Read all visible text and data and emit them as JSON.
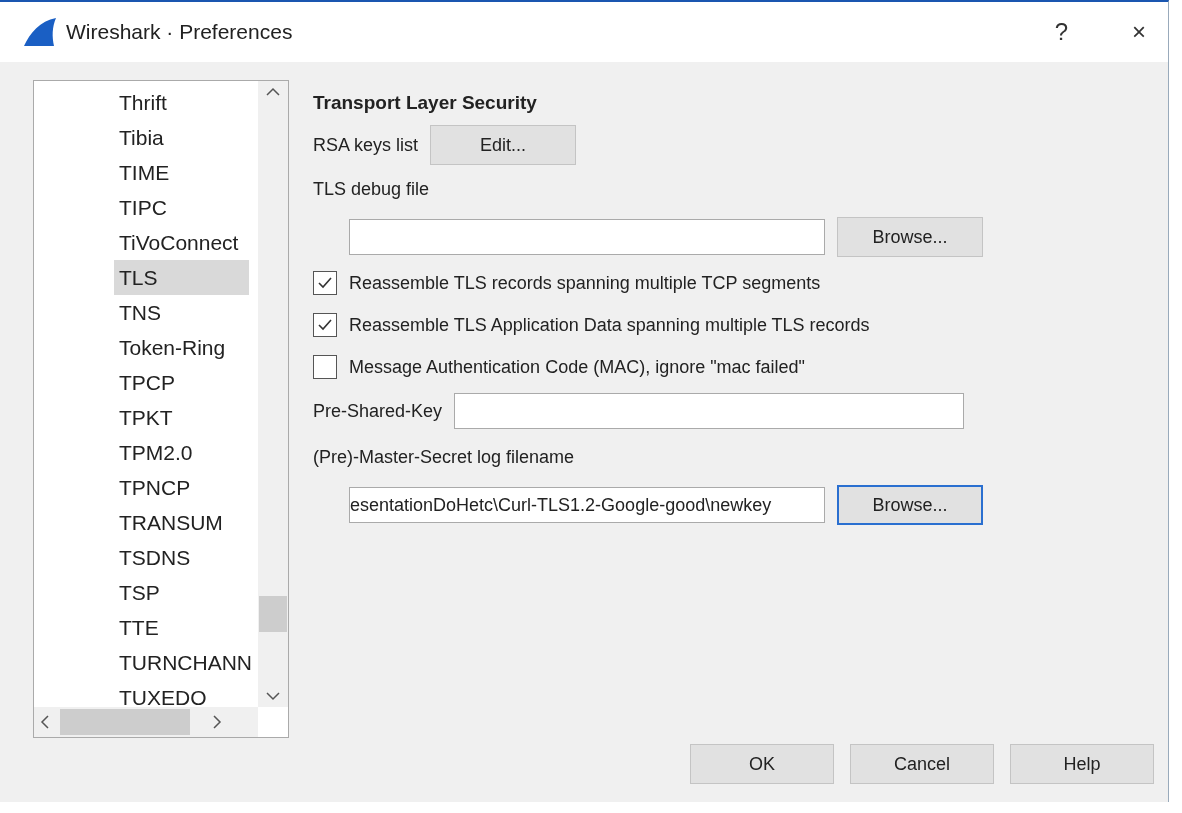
{
  "window": {
    "title": "Wireshark · Preferences",
    "help_glyph": "?",
    "close_glyph": "×"
  },
  "tree": {
    "items": [
      {
        "label": "Thrift",
        "selected": false
      },
      {
        "label": "Tibia",
        "selected": false
      },
      {
        "label": "TIME",
        "selected": false
      },
      {
        "label": "TIPC",
        "selected": false
      },
      {
        "label": "TiVoConnect",
        "selected": false
      },
      {
        "label": "TLS",
        "selected": true
      },
      {
        "label": "TNS",
        "selected": false
      },
      {
        "label": "Token-Ring",
        "selected": false
      },
      {
        "label": "TPCP",
        "selected": false
      },
      {
        "label": "TPKT",
        "selected": false
      },
      {
        "label": "TPM2.0",
        "selected": false
      },
      {
        "label": "TPNCP",
        "selected": false
      },
      {
        "label": "TRANSUM",
        "selected": false
      },
      {
        "label": "TSDNS",
        "selected": false
      },
      {
        "label": "TSP",
        "selected": false
      },
      {
        "label": "TTE",
        "selected": false
      },
      {
        "label": "TURNCHANN",
        "selected": false
      },
      {
        "label": "TUXEDO",
        "selected": false
      }
    ]
  },
  "panel": {
    "heading": "Transport Layer Security",
    "rows": [
      {
        "kind": "button",
        "label": "RSA keys list",
        "button": "Edit..."
      },
      {
        "kind": "label",
        "label": "TLS debug file"
      },
      {
        "kind": "file",
        "value": "",
        "button": "Browse...",
        "focused": false
      },
      {
        "kind": "check",
        "label": "Reassemble TLS records spanning multiple TCP segments",
        "checked": true
      },
      {
        "kind": "check",
        "label": "Reassemble TLS Application Data spanning multiple TLS records",
        "checked": true
      },
      {
        "kind": "check",
        "label": "Message Authentication Code (MAC), ignore \"mac failed\"",
        "checked": false
      },
      {
        "kind": "text",
        "label": "Pre-Shared-Key",
        "value": ""
      },
      {
        "kind": "label",
        "label": "(Pre)-Master-Secret log filename"
      },
      {
        "kind": "file",
        "value": "esentationDoHetc\\Curl-TLS1.2-Google-good\\newkey",
        "button": "Browse...",
        "focused": true
      }
    ]
  },
  "buttons": [
    "OK",
    "Cancel",
    "Help"
  ]
}
